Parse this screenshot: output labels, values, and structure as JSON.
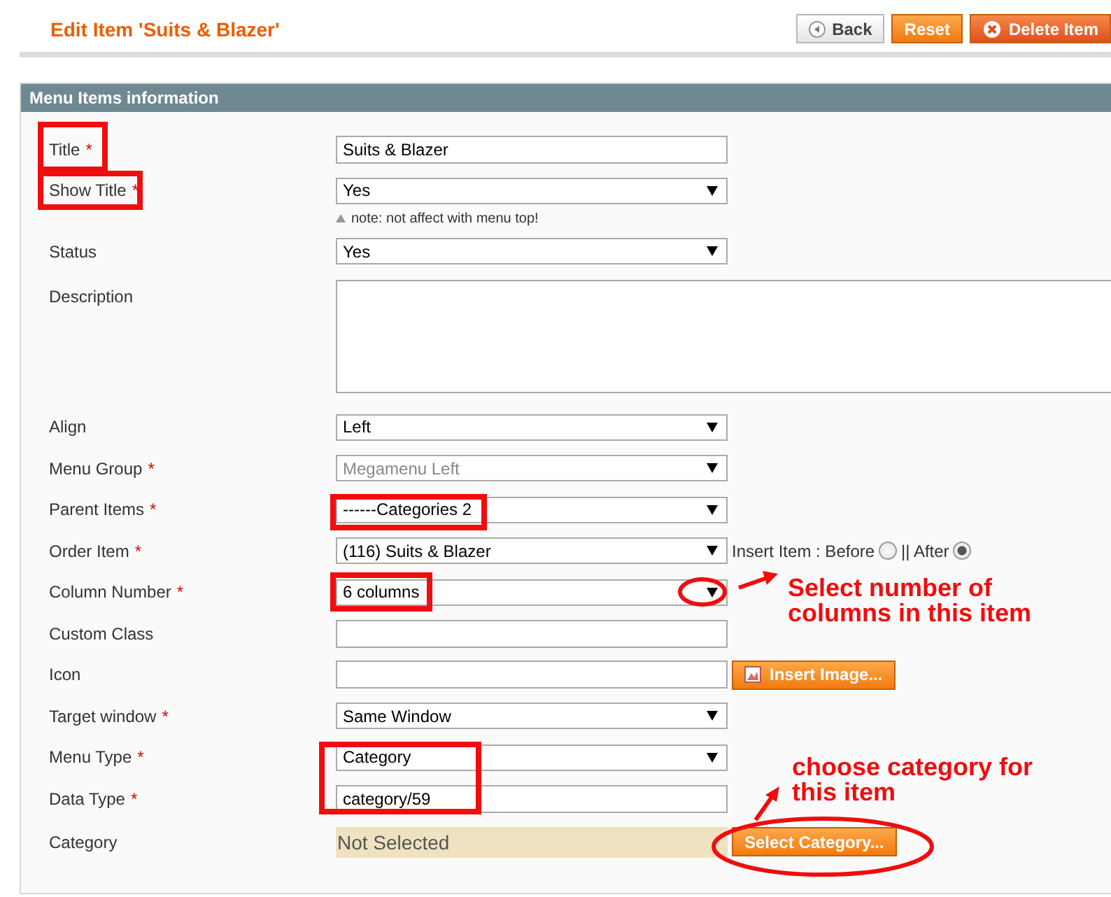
{
  "header": {
    "title": "Edit Item 'Suits & Blazer'",
    "buttons": [
      {
        "kind": "back",
        "label": "Back"
      },
      {
        "kind": "reset",
        "label": "Reset"
      },
      {
        "kind": "delete",
        "label": "Delete Item"
      }
    ]
  },
  "panel": {
    "title": "Menu Items information",
    "fields": [
      {
        "kind": "text",
        "label": "Title",
        "mark": "*",
        "value": "Suits & Blazer"
      },
      {
        "kind": "select",
        "label": "Show Title",
        "mark": "*",
        "value": "Yes",
        "note": "note: not affect with menu top!"
      },
      {
        "kind": "select",
        "label": "Status",
        "value": "Yes"
      },
      {
        "kind": "textarea",
        "label": "Description"
      },
      {
        "kind": "select",
        "label": "Align",
        "value": "Left"
      },
      {
        "kind": "select",
        "label": "Menu Group",
        "mark": "*",
        "value": "Megamenu Left",
        "disabled": true
      },
      {
        "kind": "select",
        "label": "Parent Items",
        "mark": "*",
        "value": "------Categories 2"
      },
      {
        "kind": "order",
        "label": "Order Item",
        "mark": "*",
        "value": "(116) Suits & Blazer",
        "options": [
          {
            "label": "Insert Item : Before",
            "selected": false
          },
          {
            "label": " || After",
            "selected": true
          }
        ]
      },
      {
        "kind": "select",
        "label": "Column Number",
        "mark": "*",
        "value": "6 columns"
      },
      {
        "kind": "text",
        "label": "Custom Class"
      },
      {
        "kind": "image",
        "label": "Icon",
        "button": "Insert Image..."
      },
      {
        "kind": "select",
        "label": "Target window",
        "mark": "*",
        "value": "Same Window"
      },
      {
        "kind": "select",
        "label": "Menu Type",
        "mark": "*",
        "value": "Category"
      },
      {
        "kind": "text",
        "label": "Data Type",
        "mark": "*",
        "value": "category/59"
      },
      {
        "kind": "category",
        "label": "Category",
        "value": "Not Selected",
        "button": "Select Category..."
      }
    ]
  },
  "annotations": [
    {
      "lines": [
        "Select number of",
        "columns in this item"
      ]
    },
    {
      "lines": [
        "choose category for",
        "this item"
      ]
    }
  ]
}
